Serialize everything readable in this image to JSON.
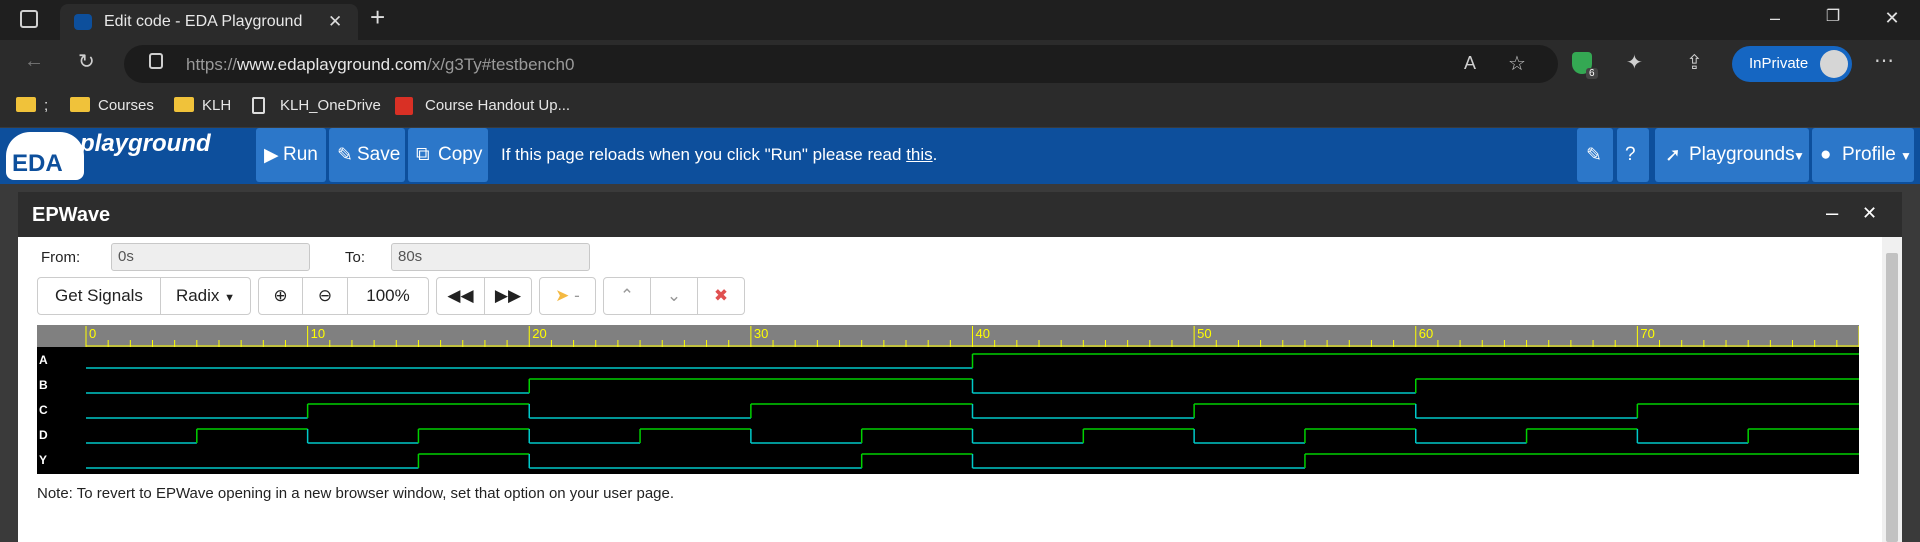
{
  "browser": {
    "tab_title": "Edit code - EDA Playground",
    "new_tab": "+",
    "url_prefix": "https://",
    "url_domain": "www.edaplayground.com",
    "url_path": "/x/g3Ty#testbench0",
    "shield_count": "6",
    "inprivate_label": "InPrivate",
    "bookmarks": [
      ";",
      "Courses",
      "KLH",
      "KLH_OneDrive",
      "Course Handout Up..."
    ]
  },
  "eda": {
    "logo_text": "EDA",
    "logo_play": "playground",
    "run_label": "Run",
    "save_label": "Save",
    "copy_label": "Copy",
    "message": "If this page reloads when you click \"Run\" please read ",
    "message_link": "this",
    "message_end": ".",
    "playgrounds_label": "Playgrounds",
    "profile_label": "Profile"
  },
  "epwave": {
    "title": "EPWave",
    "minimize": "–",
    "close": "✕",
    "from_label": "From:",
    "from_value": "0s",
    "to_label": "To:",
    "to_value": "80s",
    "get_signals": "Get Signals",
    "radix": "Radix",
    "zoom_level": "100%",
    "cursor_label": "-",
    "note": "Note: To revert to EPWave opening in a new browser window, set that option on your user page."
  },
  "chart_data": {
    "type": "line",
    "x_range": [
      0,
      80
    ],
    "x_ticks": [
      "0",
      "10",
      "20",
      "30",
      "40",
      "50",
      "60",
      "70"
    ],
    "signals": [
      {
        "name": "A",
        "transitions": [
          [
            0,
            0
          ],
          [
            40,
            1
          ]
        ]
      },
      {
        "name": "B",
        "transitions": [
          [
            0,
            0
          ],
          [
            20,
            1
          ],
          [
            40,
            0
          ],
          [
            60,
            1
          ]
        ]
      },
      {
        "name": "C",
        "transitions": [
          [
            0,
            0
          ],
          [
            10,
            1
          ],
          [
            20,
            0
          ],
          [
            30,
            1
          ],
          [
            40,
            0
          ],
          [
            50,
            1
          ],
          [
            60,
            0
          ],
          [
            70,
            1
          ]
        ]
      },
      {
        "name": "D",
        "transitions": [
          [
            0,
            0
          ],
          [
            5,
            1
          ],
          [
            10,
            0
          ],
          [
            15,
            1
          ],
          [
            20,
            0
          ],
          [
            25,
            1
          ],
          [
            30,
            0
          ],
          [
            35,
            1
          ],
          [
            40,
            0
          ],
          [
            45,
            1
          ],
          [
            50,
            0
          ],
          [
            55,
            1
          ],
          [
            60,
            0
          ],
          [
            65,
            1
          ],
          [
            70,
            0
          ],
          [
            75,
            1
          ]
        ]
      },
      {
        "name": "Y",
        "transitions": [
          [
            0,
            0
          ],
          [
            15,
            1
          ],
          [
            20,
            0
          ],
          [
            35,
            1
          ],
          [
            40,
            0
          ],
          [
            55,
            1
          ]
        ]
      }
    ],
    "colors": {
      "low": "#00c8c8",
      "high": "#00d000",
      "ruler_text": "#ffff00"
    }
  }
}
